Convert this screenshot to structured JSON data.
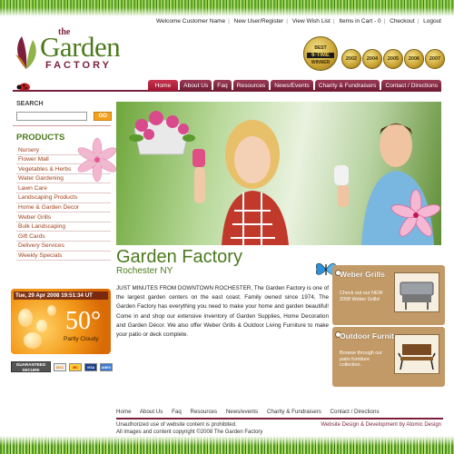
{
  "site": {
    "logo": {
      "the": "the",
      "garden": "Garden",
      "factory": "FACTORY"
    },
    "top_links": [
      "Welcome Customer Name",
      "New User/Register",
      "View Wish List",
      "Items in Cart - 0",
      "Checkout",
      "Logout"
    ],
    "awards": {
      "main_badge_lines": [
        "BEST",
        "6-TIME",
        "WINNER"
      ],
      "years": [
        "2002",
        "2004",
        "2005",
        "2006",
        "2007"
      ]
    }
  },
  "nav": {
    "tabs": [
      "Home",
      "About Us",
      "Faq",
      "Resources",
      "News/Events",
      "Charity & Fundraisers",
      "Contact / Directions"
    ],
    "active": "Home"
  },
  "search": {
    "label": "SEARCH",
    "placeholder": "",
    "button": "GO"
  },
  "products": {
    "heading": "PRODUCTS",
    "items": [
      "Nursery",
      "Flower Mall",
      "Vegetables & Herbs",
      "Water Gardening",
      "Lawn Care",
      "Landscaping Products",
      "Home & Garden Decor",
      "Weber Grills",
      "Bulk Landscaping",
      "Gift Cards",
      "Delivery Services",
      "Weekly Specials"
    ]
  },
  "weather": {
    "date": "Tue, 29 Apr 2008 19:51:34 UT",
    "temp": "50°",
    "condition": "Partly Cloudy"
  },
  "payments": {
    "secure": "GUARANTEED SECURE",
    "cards": [
      "DISC",
      "MC",
      "VISA",
      "AMEX"
    ]
  },
  "main": {
    "title": "Garden Factory",
    "subtitle": "Rochester NY",
    "body": "JUST MINUTES FROM DOWNTOWN ROCHESTER, The Garden Factory is one of the largest garden centers on the east coast. Family owned since 1974, The Garden Factory has everything you need to make your home and garden beautiful! Come in and shop our extensive inventory of Garden Supplies, Home Decoration and Garden Décor. We also offer Weber Grills & Outdoor Living Furniture to make your patio or deck complete."
  },
  "promos": [
    {
      "title": "Weber Grills",
      "text": "Check out our NEW 2008 Weber Grills!"
    },
    {
      "title": "Outdoor Furniture",
      "text": "Browse through our patio furniture collection."
    }
  ],
  "footer": {
    "nav": [
      "Home",
      "About Us",
      "Faq",
      "Resources",
      "News/events",
      "Charity & Fundraisers",
      "Contact / Directions"
    ],
    "copy_lines": [
      "Unauthorized use of website content is prohibited.",
      "All images and content copyright ©2008 The Garden Factory"
    ],
    "credit": "Website Design & Development by Atomic Design"
  },
  "colors": {
    "maroon": "#7b1f3a",
    "green": "#4b7a1c",
    "orange": "#f4a21c",
    "tag": "#c29a67"
  }
}
